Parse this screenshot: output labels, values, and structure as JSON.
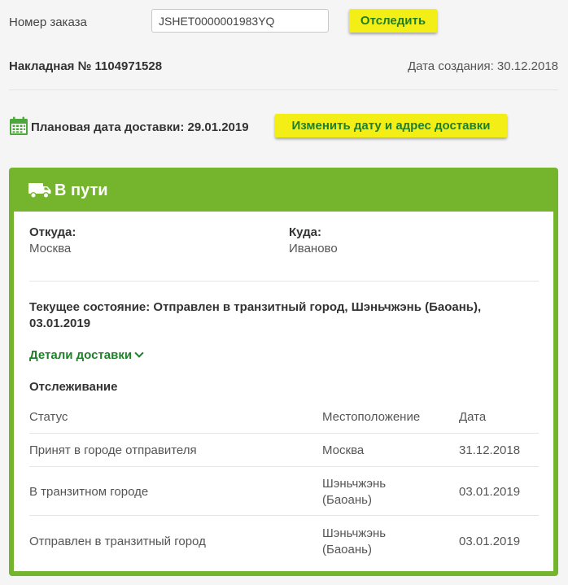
{
  "search": {
    "label": "Номер заказа",
    "value": "JSHET0000001983YQ",
    "button": "Отследить"
  },
  "waybill": {
    "title": "Накладная № 1104971528",
    "created": "Дата создания: 30.12.2018"
  },
  "planned": {
    "text": "Плановая дата доставки: 29.01.2019",
    "button": "Изменить дату и адрес доставки"
  },
  "colors": {
    "accent_green": "#75b52e",
    "link_green": "#1f7f2a",
    "button_yellow": "#f2ee16"
  },
  "shipment": {
    "status": "В пути",
    "status_icon": "truck-icon",
    "from_label": "Откуда:",
    "from_value": "Москва",
    "to_label": "Куда:",
    "to_value": "Иваново",
    "current": "Текущее состояние: Отправлен в транзитный город, Шэньчжэнь (Баоань), 03.01.2019",
    "details_link": "Детали доставки"
  },
  "tracking": {
    "title": "Отслеживание",
    "headers": [
      "Статус",
      "Местоположение",
      "Дата"
    ],
    "rows": [
      [
        "Принят в городе отправителя",
        "Москва",
        "31.12.2018"
      ],
      [
        "В транзитном городе",
        "Шэньчжэнь\n(Баоань)",
        "03.01.2019"
      ],
      [
        "Отправлен в транзитный город",
        "Шэньчжэнь\n(Баоань)",
        "03.01.2019"
      ]
    ]
  }
}
